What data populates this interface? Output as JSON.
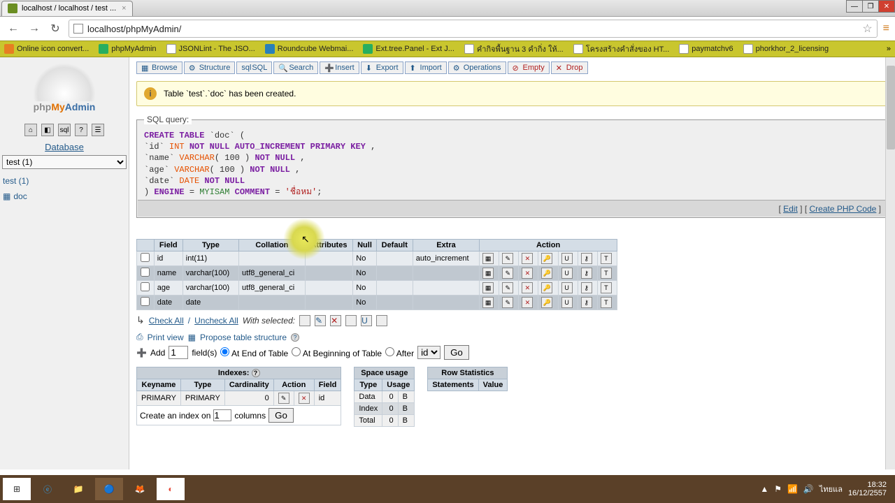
{
  "browser": {
    "tab_title": "localhost / localhost / test ...",
    "url": "localhost/phpMyAdmin/",
    "bookmarks": [
      "Online icon convert...",
      "phpMyAdmin",
      "JSONLint - The JSO...",
      "Roundcube Webmai...",
      "Ext.tree.Panel - Ext J...",
      "คำกิจพื้นฐาน 3 คำกิ่ง ให้...",
      "โครงสร้างคำสั่งของ HT...",
      "paymatchv6",
      "phorkhor_2_licensing"
    ]
  },
  "sidebar": {
    "db_header": "Database",
    "db_selected": "test (1)",
    "tree_db": "test (1)",
    "tree_table": "doc"
  },
  "tabs": [
    "Browse",
    "Structure",
    "SQL",
    "Search",
    "Insert",
    "Export",
    "Import",
    "Operations",
    "Empty",
    "Drop"
  ],
  "notice": "Table `test`.`doc` has been created.",
  "sql_legend": "SQL query:",
  "sql_links": {
    "edit": "Edit",
    "php": "Create PHP Code"
  },
  "sql_lines": [
    [
      {
        "t": "CREATE TABLE",
        "c": "kw-purple"
      },
      {
        "t": " `doc` (",
        "c": "kw-dark"
      }
    ],
    [
      {
        "t": "  `id` ",
        "c": "kw-dark"
      },
      {
        "t": "INT",
        "c": "kw-orange"
      },
      {
        "t": " NOT NULL AUTO_INCREMENT PRIMARY KEY",
        "c": "kw-purple"
      },
      {
        "t": " ,",
        "c": "kw-dark"
      }
    ],
    [
      {
        "t": "  `name` ",
        "c": "kw-dark"
      },
      {
        "t": "VARCHAR",
        "c": "kw-orange"
      },
      {
        "t": "( 100 )",
        "c": "kw-dark"
      },
      {
        "t": " NOT NULL",
        "c": "kw-purple"
      },
      {
        "t": " ,",
        "c": "kw-dark"
      }
    ],
    [
      {
        "t": "  `age` ",
        "c": "kw-dark"
      },
      {
        "t": "VARCHAR",
        "c": "kw-orange"
      },
      {
        "t": "( 100 )",
        "c": "kw-dark"
      },
      {
        "t": " NOT NULL",
        "c": "kw-purple"
      },
      {
        "t": " ,",
        "c": "kw-dark"
      }
    ],
    [
      {
        "t": "  `date` ",
        "c": "kw-dark"
      },
      {
        "t": "DATE",
        "c": "kw-orange"
      },
      {
        "t": " NOT NULL",
        "c": "kw-purple"
      }
    ],
    [
      {
        "t": ") ",
        "c": "kw-dark"
      },
      {
        "t": "ENGINE",
        "c": "kw-purple"
      },
      {
        "t": " = ",
        "c": "kw-dark"
      },
      {
        "t": "MYISAM",
        "c": "kw-green"
      },
      {
        "t": " COMMENT",
        "c": "kw-purple"
      },
      {
        "t": " = ",
        "c": "kw-dark"
      },
      {
        "t": "'ชื่อหม'",
        "c": "lit"
      },
      {
        "t": ";",
        "c": "kw-dark"
      }
    ]
  ],
  "struct_headers": [
    "",
    "Field",
    "Type",
    "Collation",
    "Attributes",
    "Null",
    "Default",
    "Extra",
    "Action"
  ],
  "struct_rows": [
    {
      "field": "id",
      "type": "int(11)",
      "coll": "",
      "attr": "",
      "null": "No",
      "def": "",
      "extra": "auto_increment",
      "ul": true
    },
    {
      "field": "name",
      "type": "varchar(100)",
      "coll": "utf8_general_ci",
      "attr": "",
      "null": "No",
      "def": "",
      "extra": ""
    },
    {
      "field": "age",
      "type": "varchar(100)",
      "coll": "utf8_general_ci",
      "attr": "",
      "null": "No",
      "def": "",
      "extra": ""
    },
    {
      "field": "date",
      "type": "date",
      "coll": "",
      "attr": "",
      "null": "No",
      "def": "",
      "extra": ""
    }
  ],
  "check_row": {
    "check": "Check All",
    "uncheck": "Uncheck All",
    "with": "With selected:"
  },
  "print_row": {
    "print": "Print view",
    "propose": "Propose table structure"
  },
  "add_row": {
    "add": "Add",
    "val": "1",
    "fields": "field(s)",
    "opt1": "At End of Table",
    "opt2": "At Beginning of Table",
    "opt3": "After",
    "sel": "id",
    "go": "Go"
  },
  "indexes": {
    "title": "Indexes:",
    "headers": [
      "Keyname",
      "Type",
      "Cardinality",
      "Action",
      "Field"
    ],
    "row": {
      "key": "PRIMARY",
      "type": "PRIMARY",
      "card": "0",
      "field": "id"
    },
    "create_lbl": "Create an index on",
    "create_val": "1",
    "cols": "columns",
    "go": "Go"
  },
  "space": {
    "title": "Space usage",
    "headers": [
      "Type",
      "Usage"
    ],
    "rows": [
      [
        "Data",
        "0",
        "B"
      ],
      [
        "Index",
        "0",
        "B"
      ],
      [
        "Total",
        "0",
        "B"
      ]
    ]
  },
  "rowstats": {
    "title": "Row Statistics",
    "headers": [
      "Statements",
      "Value"
    ]
  },
  "taskbar": {
    "time": "18:32",
    "date": "16/12/2557",
    "lang": "ไทยแล"
  }
}
